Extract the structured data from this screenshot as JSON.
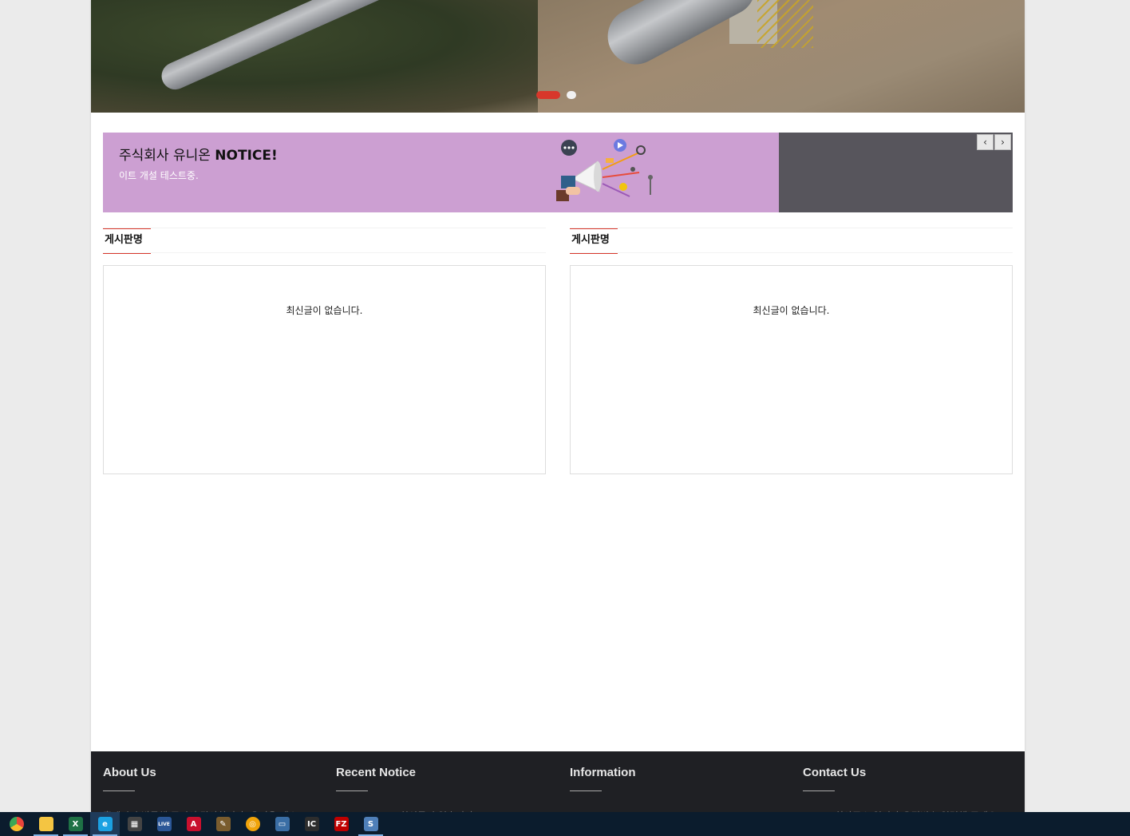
{
  "hero": {
    "slides": [
      {
        "label": "slide-1",
        "active": true
      },
      {
        "label": "slide-2",
        "active": false
      }
    ],
    "accent": "#d8372b"
  },
  "notice": {
    "title_prefix": "주식회사 유니온 ",
    "title_bold": "NOTICE!",
    "subtitle": "이트 개설 테스트중.",
    "prev_label": "‹",
    "next_label": "›",
    "bg_color": "#cc9fd2"
  },
  "boards": [
    {
      "title": "게시판명",
      "empty_text": "최신글이 없습니다."
    },
    {
      "title": "게시판명",
      "empty_text": "최신글이 없습니다."
    }
  ],
  "footer": {
    "columns": [
      {
        "title": "About Us",
        "text": "홈페이지 방문해 주셔서 감사합니다. 유니온 테스트"
      },
      {
        "title": "Recent Notice",
        "text": "최신글이 없습니다."
      },
      {
        "title": "Information",
        "text": ""
      },
      {
        "title": "Contact Us",
        "text": "회사주소 입니다 우편번호 입력해 주세요"
      }
    ]
  },
  "taskbar": {
    "items": [
      {
        "icon": "chrome-icon",
        "glyph": "",
        "color": "#e8453c"
      },
      {
        "icon": "file-explorer-icon",
        "glyph": "",
        "color": "#f4c542"
      },
      {
        "icon": "excel-icon",
        "glyph": "X",
        "color": "#1e7145"
      },
      {
        "icon": "internet-explorer-icon",
        "glyph": "e",
        "color": "#1ba1e2"
      },
      {
        "icon": "calculator-icon",
        "glyph": "▦",
        "color": "#444444"
      },
      {
        "icon": "live-app-icon",
        "glyph": "LIVE",
        "color": "#2b5797"
      },
      {
        "icon": "autocad-icon",
        "glyph": "A",
        "color": "#c8102e"
      },
      {
        "icon": "paint-icon",
        "glyph": "✎",
        "color": "#7a5c2e"
      },
      {
        "icon": "network-icon",
        "glyph": "◎",
        "color": "#f0a30a"
      },
      {
        "icon": "remote-desktop-icon",
        "glyph": "▭",
        "color": "#3a6ea5"
      },
      {
        "icon": "intellij-icon",
        "glyph": "IC",
        "color": "#2d2d2d"
      },
      {
        "icon": "filezilla-icon",
        "glyph": "FZ",
        "color": "#bf0000"
      },
      {
        "icon": "sublime-icon",
        "glyph": "S",
        "color": "#4f7fb8"
      }
    ]
  }
}
